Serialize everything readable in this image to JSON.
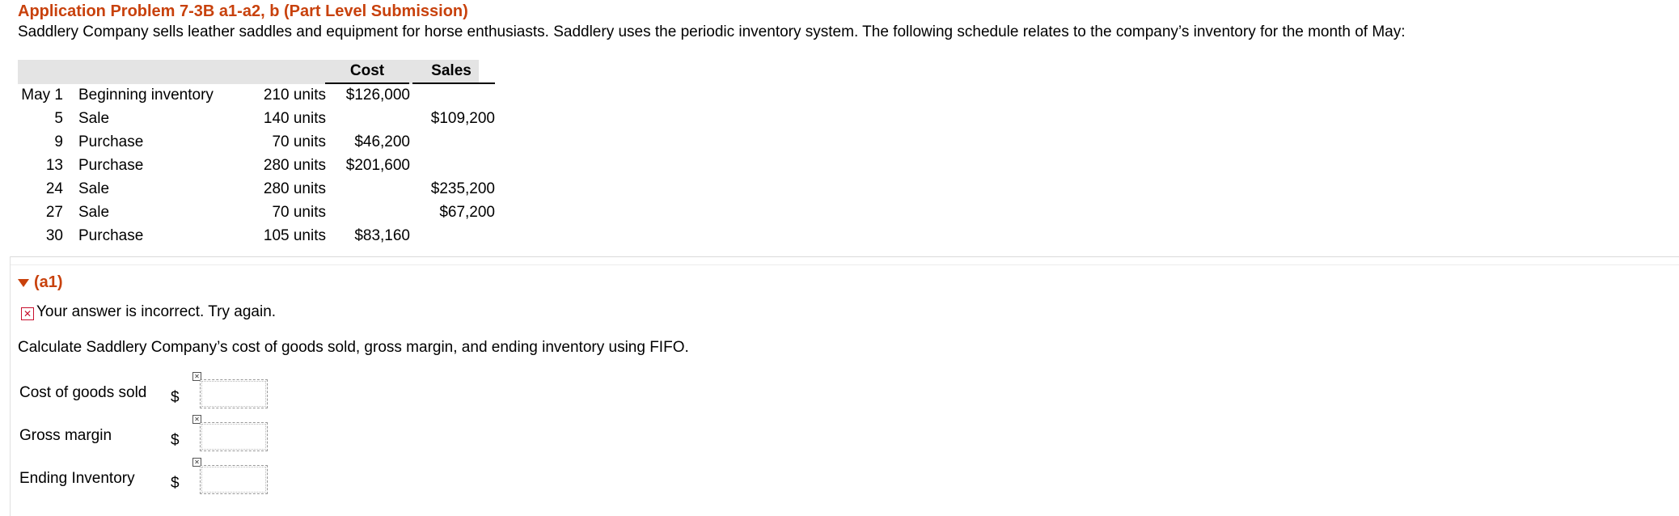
{
  "title": "Application Problem 7-3B a1-a2, b (Part Level Submission)",
  "intro": "Saddlery Company sells leather saddles and equipment for horse enthusiasts. Saddlery uses the periodic inventory system. The following schedule relates to the company’s inventory for the month of May:",
  "schedule": {
    "headers": {
      "cost": "Cost",
      "sales": "Sales"
    },
    "rows": [
      {
        "day": "May 1",
        "desc": "Beginning inventory",
        "units": "210 units",
        "cost": "$126,000",
        "sales": ""
      },
      {
        "day": "5",
        "desc": "Sale",
        "units": "140 units",
        "cost": "",
        "sales": "$109,200"
      },
      {
        "day": "9",
        "desc": "Purchase",
        "units": "70 units",
        "cost": "$46,200",
        "sales": ""
      },
      {
        "day": "13",
        "desc": "Purchase",
        "units": "280 units",
        "cost": "$201,600",
        "sales": ""
      },
      {
        "day": "24",
        "desc": "Sale",
        "units": "280 units",
        "cost": "",
        "sales": "$235,200"
      },
      {
        "day": "27",
        "desc": "Sale",
        "units": "70 units",
        "cost": "",
        "sales": "$67,200"
      },
      {
        "day": "30",
        "desc": "Purchase",
        "units": "105 units",
        "cost": "$83,160",
        "sales": ""
      }
    ]
  },
  "section": {
    "label": "(a1)",
    "feedback": "Your answer is incorrect.  Try again.",
    "question": "Calculate Saddlery Company’s cost of goods sold, gross margin, and ending inventory using FIFO."
  },
  "fields": [
    {
      "label": "Cost of goods sold",
      "currency": "$",
      "value": ""
    },
    {
      "label": "Gross margin",
      "currency": "$",
      "value": ""
    },
    {
      "label": "Ending Inventory",
      "currency": "$",
      "value": ""
    }
  ],
  "colors": {
    "accent": "#c8410c",
    "error": "#c8102e",
    "header_bg": "#e4e4e4"
  },
  "icons": {
    "collapse": "triangle-down-icon",
    "error": "x-box-icon"
  }
}
